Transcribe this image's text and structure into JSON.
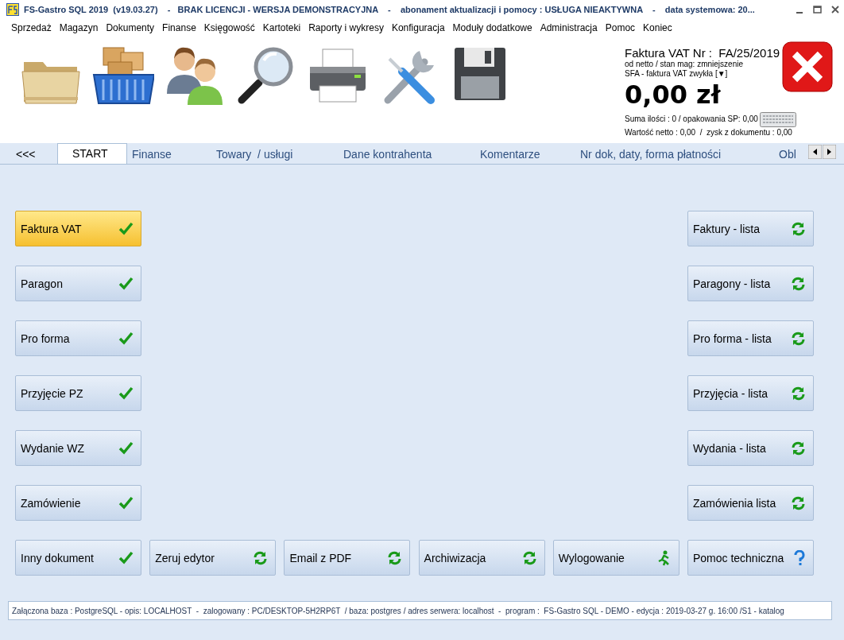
{
  "window": {
    "title": "FS-Gastro SQL 2019  (v19.03.27)    -   BRAK LICENCJI - WERSJA DEMONSTRACYJNA    -    abonament aktualizacji i pomocy : USŁUGA NIEAKTYWNA    -    data systemowa: 20..."
  },
  "menu": [
    "Sprzedaż",
    "Magazyn",
    "Dokumenty",
    "Finanse",
    "Księgowość",
    "Kartoteki",
    "Raporty i wykresy",
    "Konfiguracja",
    "Moduły dodatkowe",
    "Administracja",
    "Pomoc",
    "Koniec"
  ],
  "document": {
    "title": "Faktura VAT Nr :  FA/25/2019",
    "mode": "od netto / stan mag: zmniejszenie",
    "type": "SFA - faktura VAT zwykła [▼]",
    "total": "0,00 zł",
    "summary_1": "Suma ilości : 0 / opakowania SP: 0,00",
    "summary_2": "Wartość netto : 0,00  /  zysk z dokumentu : 0,00"
  },
  "tabs": [
    {
      "label": "<<<",
      "selected": false
    },
    {
      "label": "START",
      "selected": true
    },
    {
      "label": "Finanse",
      "selected": false
    },
    {
      "label": "Towary  / usługi",
      "selected": false
    },
    {
      "label": "Dane kontrahenta",
      "selected": false
    },
    {
      "label": "Komentarze",
      "selected": false
    },
    {
      "label": "Nr dok, daty, forma płatności",
      "selected": false
    },
    {
      "label": "Obl",
      "selected": false
    }
  ],
  "left_buttons": [
    {
      "label": "Faktura VAT",
      "kind": "check",
      "selected": true
    },
    {
      "label": "Paragon",
      "kind": "check",
      "selected": false
    },
    {
      "label": "Pro forma",
      "kind": "check",
      "selected": false
    },
    {
      "label": "Przyjęcie PZ",
      "kind": "check",
      "selected": false
    },
    {
      "label": "Wydanie WZ",
      "kind": "check",
      "selected": false
    },
    {
      "label": "Zamówienie",
      "kind": "check",
      "selected": false
    }
  ],
  "right_buttons": [
    {
      "label": "Faktury - lista",
      "kind": "refresh",
      "selected": false
    },
    {
      "label": "Paragony - lista",
      "kind": "refresh",
      "selected": false
    },
    {
      "label": "Pro forma - lista",
      "kind": "refresh",
      "selected": false
    },
    {
      "label": "Przyjęcia - lista",
      "kind": "refresh",
      "selected": false
    },
    {
      "label": "Wydania - lista",
      "kind": "refresh",
      "selected": false
    },
    {
      "label": "Zamówienia lista",
      "kind": "refresh",
      "selected": false
    }
  ],
  "bottom_buttons": [
    {
      "label": "Inny dokument",
      "kind": "check",
      "selected": false
    },
    {
      "label": "Zeruj edytor",
      "kind": "refresh",
      "selected": false
    },
    {
      "label": "Email z PDF",
      "kind": "refresh",
      "selected": false
    },
    {
      "label": "Archiwizacja",
      "kind": "refresh",
      "selected": false
    },
    {
      "label": "Wylogowanie",
      "kind": "exit",
      "selected": false
    },
    {
      "label": "Pomoc techniczna",
      "kind": "help",
      "selected": false
    }
  ],
  "status_bar": "Załączona baza : PostgreSQL - opis: LOCALHOST  -  zalogowany : PC/DESKTOP-5H2RP6T  / baza: postgres / adres serwera: localhost  -  program :  FS-Gastro SQL - DEMO - edycja : 2019-03-27 g. 16:00 /S1 - katalog"
}
